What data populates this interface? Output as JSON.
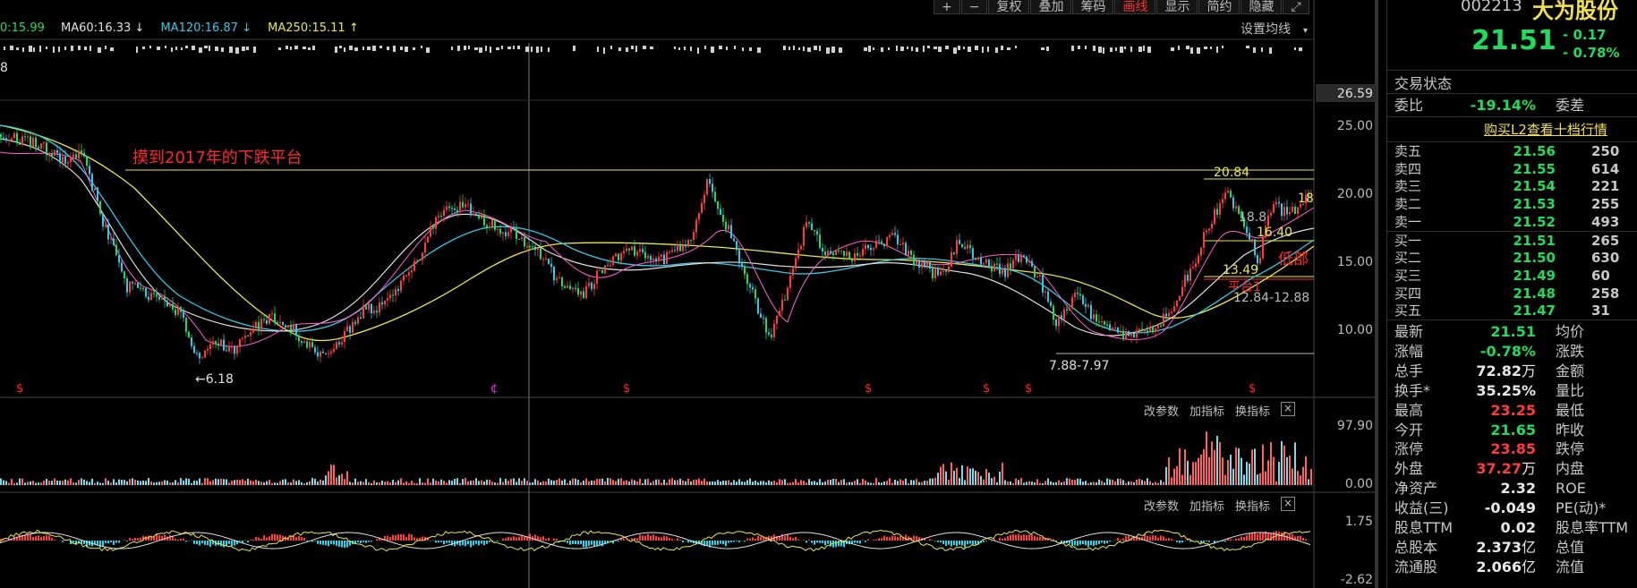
{
  "indicators": {
    "ma_a": "0:15.99",
    "ma60": "MA60:16.33",
    "ma120": "MA120:16.87",
    "ma250": "MA250:15.11",
    "down_arrow": "↓",
    "up_arrow": "↑"
  },
  "toolbar": {
    "plus": "+",
    "minus": "−",
    "fuquan": "复权",
    "diejia": "叠加",
    "chouma": "筹码",
    "huaxian": "画线",
    "xianshi": "显示",
    "jianjie": "简约",
    "yincang": "隐藏",
    "expand": "⤢"
  },
  "main_chart": {
    "settings_label": "设置均线",
    "stray_label": "8",
    "y_ticks": [
      "26.59",
      "25.00",
      "20.00",
      "15.00",
      "10.00"
    ],
    "annotations": {
      "platform": "摸到2017年的下跌平台",
      "low": "←6.18",
      "low_range": "7.88-7.97",
      "level_2084": "20.84",
      "level_188": "18.8",
      "level_1640": "16.40",
      "level_1349": "13.49",
      "range_1284": "12.84-12.88",
      "dibu": "低部",
      "pingtai": "平台1",
      "edge_18": "18"
    },
    "markers": [
      "$",
      "¢",
      "$",
      "$",
      "$",
      "$",
      "$"
    ],
    "colors": {
      "price_line": "#e8e84a",
      "annotation": "#ff2a2a",
      "marker": "#ff2a2a",
      "marker_alt": "#ff2aff",
      "ma_cyan": "#31c9e8",
      "ma_white": "#e0e0e0"
    }
  },
  "volume_panel": {
    "tools": [
      "改参数",
      "加指标",
      "换指标"
    ],
    "close": "×",
    "y_ticks": [
      "97.90",
      "0.00"
    ]
  },
  "macd_panel": {
    "tools": [
      "改参数",
      "加指标",
      "换指标"
    ],
    "close": "×",
    "y_ticks": [
      "1.75",
      "-2.62"
    ]
  },
  "quote": {
    "code": "002213",
    "name": "大为股份",
    "price": "21.51",
    "change": "- 0.17",
    "change_pct": "- 0.78%",
    "trade_status": "交易状态",
    "weibi_label": "委比",
    "weibi_value": "-19.14%",
    "weicha_label": "委差",
    "l2_link": "购买L2查看十档行情",
    "asks": [
      {
        "label": "卖五",
        "price": "21.56",
        "vol": "250"
      },
      {
        "label": "卖四",
        "price": "21.55",
        "vol": "614"
      },
      {
        "label": "卖三",
        "price": "21.54",
        "vol": "221"
      },
      {
        "label": "卖二",
        "price": "21.53",
        "vol": "255"
      },
      {
        "label": "卖一",
        "price": "21.52",
        "vol": "493"
      }
    ],
    "bids": [
      {
        "label": "买一",
        "price": "21.51",
        "vol": "265"
      },
      {
        "label": "买二",
        "price": "21.50",
        "vol": "630"
      },
      {
        "label": "买三",
        "price": "21.49",
        "vol": "60"
      },
      {
        "label": "买四",
        "price": "21.48",
        "vol": "258"
      },
      {
        "label": "买五",
        "price": "21.47",
        "vol": "31"
      }
    ],
    "stats": [
      {
        "label": "最新",
        "value": "21.51",
        "color": "green",
        "label2": "均价"
      },
      {
        "label": "涨幅",
        "value": "-0.78%",
        "color": "green",
        "label2": "涨跌"
      },
      {
        "label": "总手",
        "value": "72.82",
        "unit": "万",
        "color": "white",
        "label2": "金额"
      },
      {
        "label": "换手*",
        "value": "35.25%",
        "color": "white",
        "label2": "量比"
      },
      {
        "label": "最高",
        "value": "23.25",
        "color": "red",
        "label2": "最低"
      },
      {
        "label": "今开",
        "value": "21.65",
        "color": "green",
        "label2": "昨收"
      },
      {
        "label": "涨停",
        "value": "23.85",
        "color": "red",
        "label2": "跌停"
      },
      {
        "label": "外盘",
        "value": "37.27",
        "unit": "万",
        "color": "red",
        "label2": "内盘"
      },
      {
        "label": "净资产",
        "value": "2.32",
        "color": "white",
        "label2": "ROE"
      },
      {
        "label": "收益(三)",
        "value": "-0.049",
        "color": "white",
        "label2": "PE(动)*"
      },
      {
        "label": "股息TTM",
        "value": "0.02",
        "color": "white",
        "label2": "股息率TTM"
      },
      {
        "label": "总股本",
        "value": "2.373",
        "unit": "亿",
        "color": "white",
        "label2": "总值"
      },
      {
        "label": "流通股",
        "value": "2.066",
        "unit": "亿",
        "color": "white",
        "label2": "流值"
      }
    ]
  }
}
